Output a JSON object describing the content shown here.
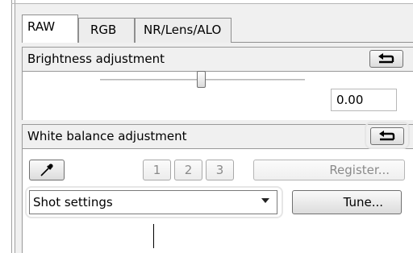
{
  "tabs": [
    {
      "label": "RAW",
      "active": true
    },
    {
      "label": "RGB",
      "active": false
    },
    {
      "label": "NR/Lens/ALO",
      "active": false
    }
  ],
  "brightness": {
    "title": "Brightness adjustment",
    "reset_icon": "undo-arrow-icon",
    "slider_level": 0.47,
    "value": "0.00"
  },
  "white_balance": {
    "title": "White balance adjustment",
    "reset_icon": "undo-arrow-icon",
    "eyedropper_icon": "eyedropper-icon",
    "preset_buttons": [
      "1",
      "2",
      "3"
    ],
    "register_label": "Register...",
    "selected_setting": "Shot settings",
    "tune_label": "Tune..."
  },
  "colors": {
    "panel_bg": "#f0f0f0",
    "highlight_ring": "#e6e6e6",
    "disabled_text": "#8a8a8a"
  }
}
